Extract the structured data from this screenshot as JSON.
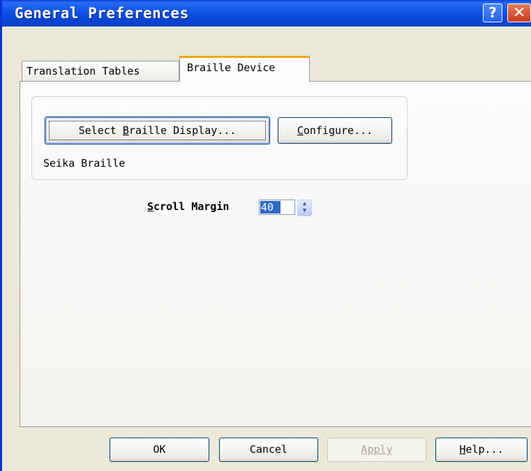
{
  "window": {
    "title": "General Preferences",
    "help_glyph": "?",
    "close_glyph": "✕"
  },
  "tabs": [
    {
      "label": "Translation Tables",
      "active": false
    },
    {
      "label": "Braille Device",
      "active": true
    }
  ],
  "device_group": {
    "select_button": {
      "pre": "Select ",
      "mnemonic": "B",
      "post": "raille Display..."
    },
    "configure_button": {
      "mnemonic": "C",
      "post": "onfigure..."
    },
    "current_device": "Seika Braille"
  },
  "scroll_margin": {
    "label_mnemonic": "S",
    "label_rest": "croll Margin",
    "value": "40"
  },
  "footer": {
    "ok": "OK",
    "cancel": "Cancel",
    "apply": "Apply",
    "help_mnemonic": "H",
    "help_rest": "elp..."
  },
  "colors": {
    "titlebar": "#0a4ad8",
    "accent_tab": "#f8a30f",
    "selection": "#316ac5"
  }
}
